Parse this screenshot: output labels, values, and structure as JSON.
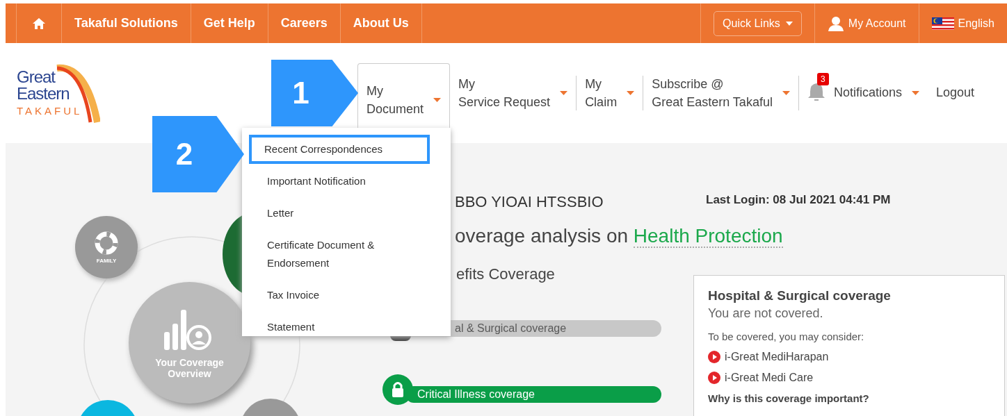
{
  "top_bar": {
    "links": [
      {
        "kind": "home"
      },
      {
        "kind": "text",
        "label": "Takaful Solutions"
      },
      {
        "kind": "text",
        "label": "Get Help"
      },
      {
        "kind": "text",
        "label": "Careers"
      },
      {
        "kind": "text",
        "label": "About Us"
      }
    ],
    "quick_links": "Quick Links",
    "my_account": "My Account",
    "language": "English"
  },
  "logo": {
    "line1": "Great",
    "line2": "Eastern",
    "line3": "TAKAFUL"
  },
  "nav": {
    "items": [
      {
        "line1": "My",
        "line2": "Document",
        "expanded": true
      },
      {
        "line1": "My",
        "line2": "Service Request",
        "expanded": false
      },
      {
        "line1": "My",
        "line2": "Claim",
        "expanded": false
      },
      {
        "line1": "Subscribe @",
        "line2": "Great Eastern Takaful",
        "expanded": false
      }
    ],
    "notifications": {
      "label": "Notifications",
      "count": "3"
    },
    "logout": "Logout"
  },
  "dropdown": [
    {
      "label": "Recent Correspondences",
      "highlighted": true
    },
    {
      "label": "Important Notification",
      "highlighted": false
    },
    {
      "label": "Letter",
      "highlighted": false
    },
    {
      "label": "Certificate Document & Endorsement",
      "highlighted": false
    },
    {
      "label": "Tax Invoice",
      "highlighted": false
    },
    {
      "label": "Statement",
      "highlighted": false
    }
  ],
  "steps": [
    "1",
    "2"
  ],
  "diagram": {
    "family": "FAMILY",
    "center": "Your Coverage Overview"
  },
  "content": {
    "name": "BBO YIOAI HTSSBIO",
    "last_login": "Last Login: 08 Jul 2021 04:41 PM",
    "heading": "overage analysis on ",
    "topic": "Health Protection",
    "subheading": "efits Coverage",
    "bars": [
      {
        "label": "al & Surgical coverage",
        "covered": false
      },
      {
        "label": "Critical Illness coverage",
        "covered": true
      }
    ]
  },
  "popup": {
    "title": "Hospital & Surgical coverage",
    "status": "You are not covered.",
    "consider": "To be covered, you may consider:",
    "products": [
      "i-Great MediHarapan",
      "i-Great Medi Care"
    ],
    "question": "Why is this coverage important?"
  }
}
